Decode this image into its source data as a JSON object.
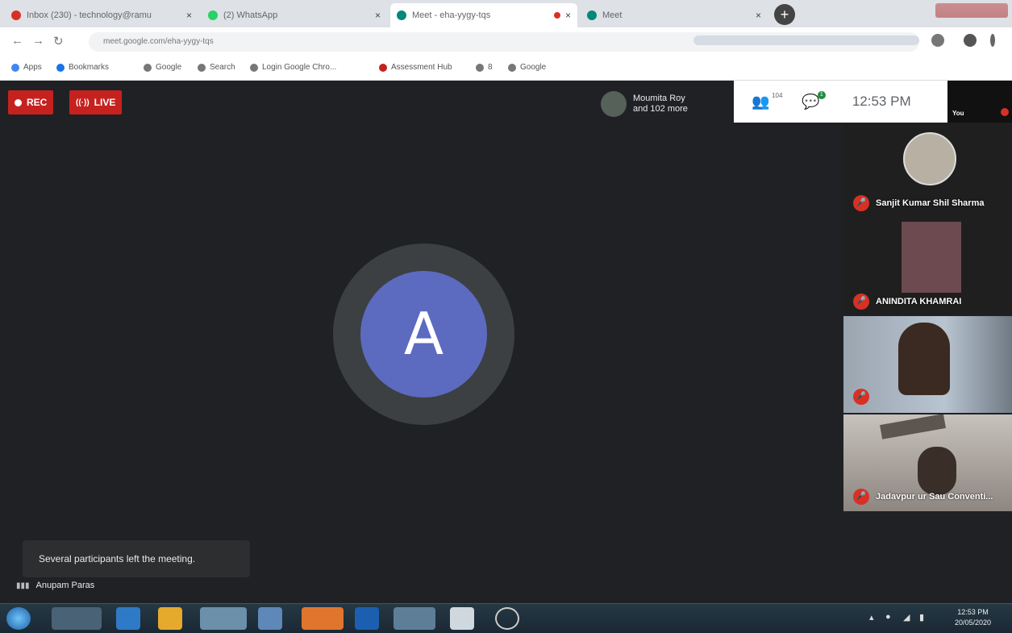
{
  "browser": {
    "tabs": [
      {
        "title": "Inbox (230) - technology@ramu",
        "fav_color": "#d93025",
        "active": false
      },
      {
        "title": "(2) WhatsApp",
        "fav_color": "#25d366",
        "active": false
      },
      {
        "title": "Meet - eha-yygy-tqs",
        "fav_color": "#00897b",
        "active": true
      },
      {
        "title": "Meet",
        "fav_color": "#00897b",
        "active": false
      }
    ],
    "close_glyph": "×",
    "new_tab_glyph": "+",
    "url": "meet.google.com/eha-yygy-tqs",
    "bookmarks": [
      {
        "label": "Apps",
        "icon_color": "#4285f4"
      },
      {
        "label": "Bookmarks",
        "icon_color": "#1a73e8"
      },
      {
        "label": "Google",
        "icon_color": "#777"
      },
      {
        "label": "Search",
        "icon_color": "#777"
      },
      {
        "label": "Login Google Chro...",
        "icon_color": "#777"
      },
      {
        "label": "Assessment Hub",
        "icon_color": "#c5221f"
      },
      {
        "label": "8",
        "icon_color": "#777"
      },
      {
        "label": "Google",
        "icon_color": "#777"
      }
    ]
  },
  "meet": {
    "rec_label": "REC",
    "live_label": "LIVE",
    "live_icon": "((·))",
    "presenter_name": "Moumita Roy",
    "presenter_more": "and 102 more",
    "participants_count": "104",
    "chat_badge": "1",
    "clock": "12:53 PM",
    "you_label": "You",
    "main_avatar_letter": "A",
    "toast": "Several participants left the meeting.",
    "speaker_name": "Anupam Paras",
    "tiles": [
      {
        "name": "Sanjit Kumar Shil Sharma",
        "has_avatar": true
      },
      {
        "name": "ANINDITA KHAMRAI",
        "has_avatar": false
      },
      {
        "name": "",
        "has_avatar": false
      },
      {
        "name": "Jadavpur ur Sau Conventi...",
        "has_avatar": false
      }
    ]
  },
  "taskbar": {
    "time": "12:53 PM",
    "date": "20/05/2020"
  }
}
